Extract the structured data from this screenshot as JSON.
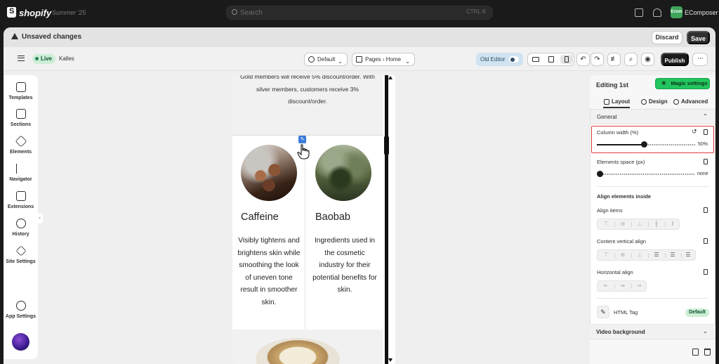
{
  "shopify": {
    "brand": "shopify",
    "edition": "Summer '25",
    "search_placeholder": "Search",
    "shortcut": "CTRL K",
    "user_initials": "Ecom",
    "user_name": "EComposer"
  },
  "unsaved": {
    "message": "Unsaved changes",
    "discard_label": "Discard",
    "save_label": "Save"
  },
  "toolbar": {
    "live_label": "Live",
    "store_name": "Kalles",
    "theme_select": "Default",
    "page_select": "Pages › Home",
    "old_editor_label": "Old Editor",
    "publish_label": "Publish",
    "more_label": "···",
    "active_device": "mobile"
  },
  "leftnav": {
    "items": [
      {
        "label": "Templates"
      },
      {
        "label": "Sections"
      },
      {
        "label": "Elements"
      },
      {
        "label": "Navigator"
      },
      {
        "label": "Extensions"
      },
      {
        "label": "History"
      },
      {
        "label": "Site Settings"
      },
      {
        "label": "App Settings"
      }
    ]
  },
  "canvas": {
    "top_text": "Gold members will receive 5% discount/order. With silver members, customers receive 3% discount/order.",
    "columns": [
      {
        "title": "Caffeine",
        "text": "Visibly tightens and brightens skin while smoothing the look of uneven tone result in smoother skin."
      },
      {
        "title": "Baobab",
        "text": "Ingredients used in the cosmetic industry for their potential benefits for skin."
      }
    ],
    "edit_icon": "pencil-icon"
  },
  "panel": {
    "title": "Editing 1st",
    "magic_label": "Magic settings",
    "tabs": [
      {
        "label": "Layout",
        "active": true
      },
      {
        "label": "Design",
        "active": false
      },
      {
        "label": "Advanced",
        "active": false
      }
    ],
    "general_label": "General",
    "column_width": {
      "label": "Column width (%)",
      "value": 50,
      "value_label": "50%"
    },
    "elements_space": {
      "label": "Elements space (px)",
      "value": 0,
      "value_label": "none"
    },
    "align_inside_title": "Align elements inside",
    "align_items_label": "Align items",
    "content_vertical_align_label": "Content vertical align",
    "horizontal_align_label": "Horizontal align",
    "html_tag_label": "HTML Tag",
    "html_tag_value": "Default",
    "video_background_label": "Video background",
    "highlight_color": "#e03c3c"
  }
}
